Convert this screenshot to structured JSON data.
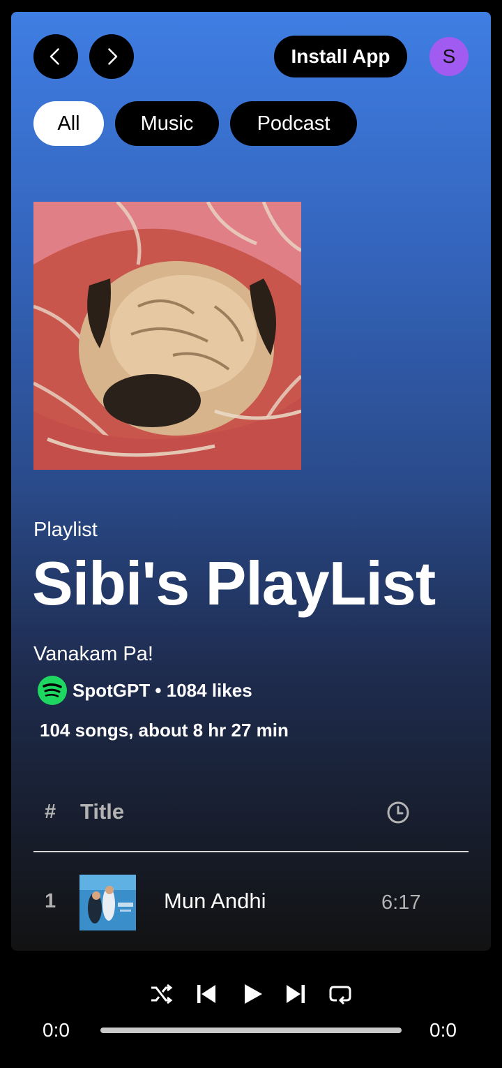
{
  "header": {
    "install_label": "Install App",
    "avatar_initial": "S"
  },
  "filters": [
    {
      "label": "All",
      "active": true
    },
    {
      "label": "Music",
      "active": false
    },
    {
      "label": "Podcast",
      "active": false
    }
  ],
  "playlist": {
    "type": "Playlist",
    "name": "Sibi's PlayList",
    "description": "Vanakam Pa!",
    "owner_line": "SpotGPT • 1084 likes",
    "stats": "104 songs, about 8 hr 27 min"
  },
  "table": {
    "col_num": "#",
    "col_title": "Title",
    "rows": [
      {
        "num": "1",
        "title": "Mun Andhi",
        "duration": "6:17"
      }
    ]
  },
  "player": {
    "time_elapsed": "0:0",
    "time_total": "0:0",
    "progress": 0
  },
  "colors": {
    "accent": "#1ed760",
    "avatar": "#a25bf0",
    "gradient_top": "#3f7ee3"
  }
}
